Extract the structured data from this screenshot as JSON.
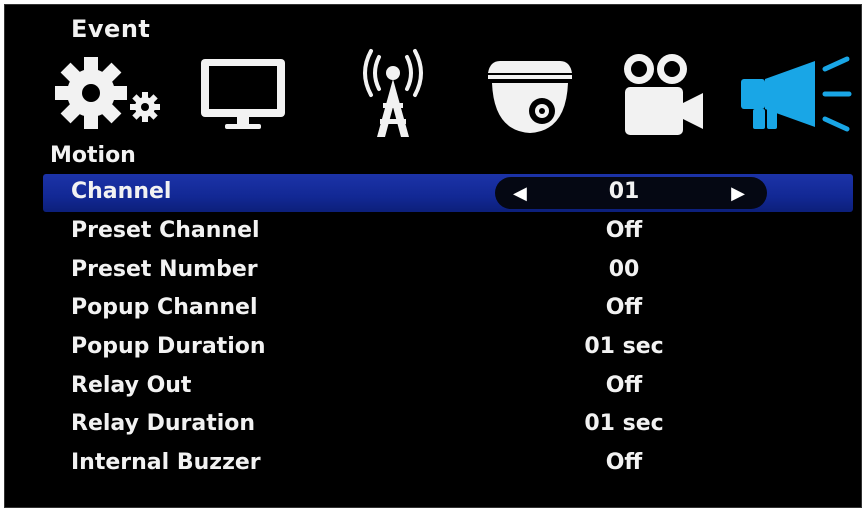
{
  "header": {
    "title": "Event"
  },
  "tabs": [
    {
      "icon": "gear-icon"
    },
    {
      "icon": "monitor-icon"
    },
    {
      "icon": "antenna-icon"
    },
    {
      "icon": "dome-camera-icon"
    },
    {
      "icon": "video-camera-icon"
    },
    {
      "icon": "megaphone-icon",
      "active": true
    }
  ],
  "section": {
    "title": "Motion"
  },
  "settings": [
    {
      "label": "Channel",
      "value": "01",
      "selected": true
    },
    {
      "label": "Preset Channel",
      "value": "Off"
    },
    {
      "label": "Preset Number",
      "value": "00"
    },
    {
      "label": "Popup Channel",
      "value": "Off"
    },
    {
      "label": "Popup Duration",
      "value": "01 sec"
    },
    {
      "label": "Relay Out",
      "value": "Off"
    },
    {
      "label": "Relay Duration",
      "value": "01 sec"
    },
    {
      "label": "Internal Buzzer",
      "value": "Off"
    }
  ],
  "colors": {
    "background": "#000000",
    "selection": "#1730a0",
    "active_icon": "#19a6e6",
    "text": "#f2f2f2"
  }
}
